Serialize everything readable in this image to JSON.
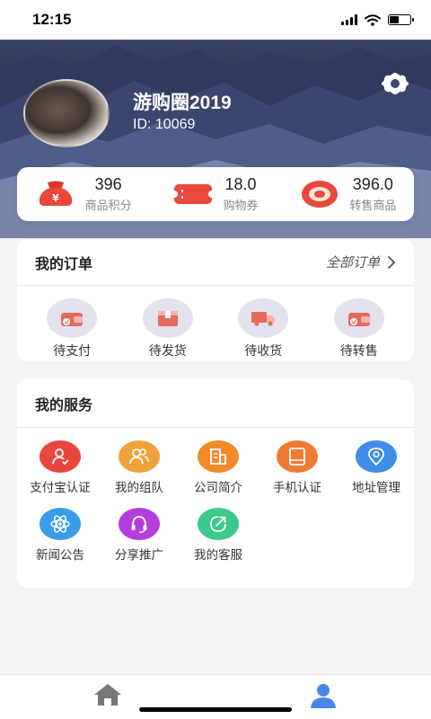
{
  "status_bar": {
    "time": "12:15"
  },
  "profile": {
    "nickname": "游购圈2019",
    "user_id": "ID: 10069"
  },
  "stats": [
    {
      "value": "396",
      "label": "商品积分",
      "icon": "money-bag-icon"
    },
    {
      "value": "18.0",
      "label": "购物券",
      "icon": "ticket-icon"
    },
    {
      "value": "396.0",
      "label": "转售商品",
      "icon": "resale-ring-icon"
    }
  ],
  "orders": {
    "title": "我的订单",
    "all_link": "全部订单",
    "items": [
      {
        "label": "待支付",
        "icon": "wallet-pay-icon"
      },
      {
        "label": "待发货",
        "icon": "package-box-icon"
      },
      {
        "label": "待收货",
        "icon": "delivery-truck-icon"
      },
      {
        "label": "待转售",
        "icon": "wallet-resale-icon"
      }
    ]
  },
  "services": {
    "title": "我的服务",
    "items": [
      {
        "label": "支付宝认证",
        "icon": "user-verify-icon",
        "color": "#e8473e"
      },
      {
        "label": "我的组队",
        "icon": "team-icon",
        "color": "#f0a23a"
      },
      {
        "label": "公司简介",
        "icon": "building-icon",
        "color": "#f08a2a"
      },
      {
        "label": "手机认证",
        "icon": "tablet-icon",
        "color": "#f07b35"
      },
      {
        "label": "地址管理",
        "icon": "location-pin-icon",
        "color": "#3f8de6"
      },
      {
        "label": "新闻公告",
        "icon": "atom-icon",
        "color": "#3a9ce8"
      },
      {
        "label": "分享推广",
        "icon": "headset-icon",
        "color": "#b23fdc"
      },
      {
        "label": "我的客服",
        "icon": "share-arrow-icon",
        "color": "#3cc98b"
      }
    ]
  },
  "tabbar": [
    {
      "name": "home",
      "icon": "home-icon",
      "color": "#777777"
    },
    {
      "name": "profile",
      "icon": "person-icon",
      "color": "#4a86e8"
    }
  ]
}
